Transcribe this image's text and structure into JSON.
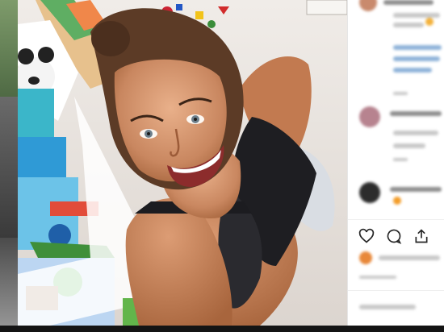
{
  "page": {
    "title": ""
  },
  "photo": {
    "description_alt": ""
  },
  "side_panel": {
    "comments": [],
    "actions": [
      {
        "icon": "heart-icon"
      },
      {
        "icon": "comment-icon"
      },
      {
        "icon": "share-icon"
      },
      {
        "icon": "bookmark-icon"
      }
    ]
  },
  "colors": {
    "panel_bg": "#ffffff",
    "link_blue": "#8fb3d9",
    "text_gray": "#8e8e8e",
    "page_bg": "#1b1b1b"
  }
}
